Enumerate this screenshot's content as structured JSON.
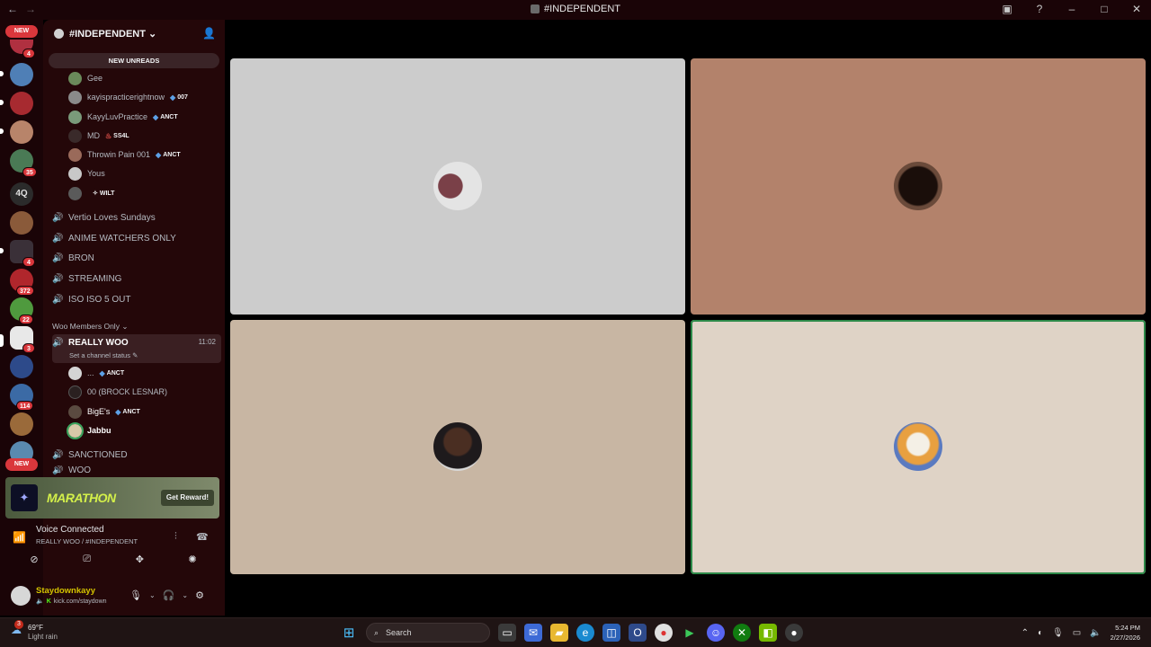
{
  "window": {
    "title": "#INDEPENDENT",
    "nav_back": "←",
    "nav_forward": "→"
  },
  "server_rail": {
    "new_label": "NEW",
    "badges": [
      "4",
      "35",
      "4",
      "372",
      "22",
      "3",
      "114"
    ],
    "text_server": "4Q"
  },
  "sidebar": {
    "server_name": "#INDEPENDENT",
    "new_unreads": "NEW UNREADS",
    "members_top": [
      {
        "name": "Gee",
        "tag": ""
      },
      {
        "name": "kayispracticerightnow",
        "tag": "007"
      },
      {
        "name": "KayyLuvPractice",
        "tag": "ANCT"
      },
      {
        "name": "MD",
        "tag": "SS4L"
      },
      {
        "name": "Throwin Pain 001",
        "tag": "ANCT"
      },
      {
        "name": "Yous",
        "tag": ""
      },
      {
        "name": "",
        "tag": "WILT"
      }
    ],
    "voice_channels": [
      "Vertio Loves Sundays",
      "ANIME WATCHERS ONLY",
      "BRON",
      "STREAMING",
      "ISO ISO 5 OUT"
    ],
    "category": "Woo Members Only",
    "active_channel": {
      "name": "REALLY WOO",
      "timer": "11:02",
      "status": "Set a channel status"
    },
    "members_active": [
      {
        "name": "...",
        "tag": "ANCT"
      },
      {
        "name": "00 (BROCK LESNAR)",
        "tag": ""
      },
      {
        "name": "BigE's",
        "tag": "ANCT"
      },
      {
        "name": "Jabbu",
        "tag": ""
      }
    ],
    "channels_after": [
      "SANCTIONED",
      "WOO"
    ]
  },
  "promo": {
    "title": "MARATHON",
    "button": "Get Reward!"
  },
  "voice_panel": {
    "status": "Voice Connected",
    "location": "REALLY WOO / #INDEPENDENT"
  },
  "user_panel": {
    "username": "Staydownkayy",
    "status": "kick.com/staydown"
  },
  "taskbar": {
    "weather_temp": "69°F",
    "weather_cond": "Light rain",
    "weather_badge": "3",
    "search_placeholder": "Search",
    "time": "5:24 PM",
    "date": "2/27/2026"
  },
  "colors": {
    "rail_bg": "#1a0407",
    "sidebar_bg": "#240709",
    "tile_1": "#cccccc",
    "tile_2": "#b3826b",
    "tile_3": "#c8b6a3",
    "tile_4": "#dfd3c6",
    "speaking_outline": "#2d8a49",
    "accent_red": "#da373c"
  }
}
